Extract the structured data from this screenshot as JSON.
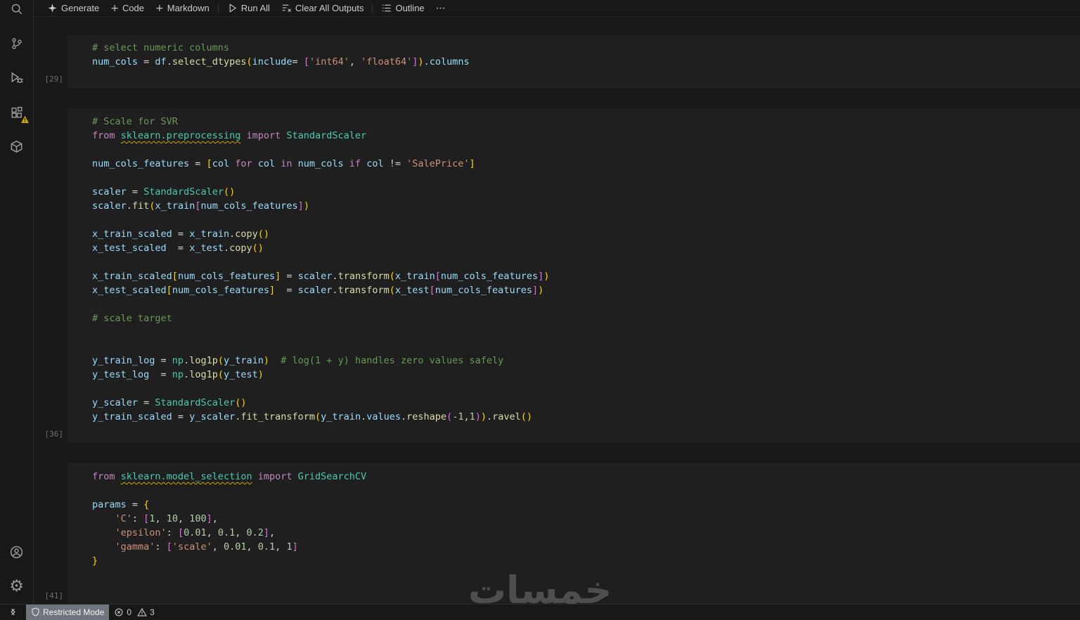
{
  "icons": {
    "plus": "+",
    "more": "⋯",
    "gear": "⚙"
  },
  "colors": {
    "background": "#181818",
    "cell_background": "#1f1f1f",
    "comment": "#6A9955",
    "keyword": "#C586C0",
    "variable": "#9CDCFE",
    "function": "#DCDCAA",
    "class": "#4EC9B0",
    "string": "#CE9178",
    "number": "#B5CEA8",
    "bracket1": "#FFD700",
    "bracket2": "#DA70D6",
    "warning_squiggle": "#CCA700"
  },
  "toolbar": {
    "generate": "Generate",
    "add_code": "Code",
    "add_markdown": "Markdown",
    "run_all": "Run All",
    "clear_all_outputs": "Clear All Outputs",
    "outline": "Outline"
  },
  "status_bar": {
    "restricted_mode": "Restricted Mode",
    "errors": "0",
    "warnings": "3"
  },
  "watermark": "خمسات",
  "cells": [
    {
      "execution_count": "[29]",
      "lines": [
        [
          [
            "c",
            "# select numeric columns"
          ]
        ],
        [
          [
            "v",
            "num_cols"
          ],
          [
            "o",
            " = "
          ],
          [
            "v",
            "df"
          ],
          [
            "p",
            "."
          ],
          [
            "f",
            "select_dtypes"
          ],
          [
            "b1",
            "("
          ],
          [
            "v",
            "include"
          ],
          [
            "o",
            "= "
          ],
          [
            "b2",
            "["
          ],
          [
            "s",
            "'int64'"
          ],
          [
            "p",
            ", "
          ],
          [
            "s",
            "'float64'"
          ],
          [
            "b2",
            "]"
          ],
          [
            "b1",
            ")"
          ],
          [
            "p",
            "."
          ],
          [
            "v",
            "columns"
          ]
        ]
      ]
    },
    {
      "execution_count": "[36]",
      "lines": [
        [
          [
            "c",
            "# Scale for SVR"
          ]
        ],
        [
          [
            "k",
            "from "
          ],
          [
            "mw",
            "sklearn.preprocessing"
          ],
          [
            "k",
            " import "
          ],
          [
            "cl",
            "StandardScaler"
          ]
        ],
        [],
        [
          [
            "v",
            "num_cols_features"
          ],
          [
            "o",
            " = "
          ],
          [
            "b1",
            "["
          ],
          [
            "v",
            "col"
          ],
          [
            "k",
            " for "
          ],
          [
            "v",
            "col"
          ],
          [
            "k",
            " in "
          ],
          [
            "v",
            "num_cols"
          ],
          [
            "k",
            " if "
          ],
          [
            "v",
            "col"
          ],
          [
            "o",
            " != "
          ],
          [
            "s",
            "'SalePrice'"
          ],
          [
            "b1",
            "]"
          ]
        ],
        [],
        [
          [
            "v",
            "scaler"
          ],
          [
            "o",
            " = "
          ],
          [
            "cl",
            "StandardScaler"
          ],
          [
            "b1",
            "()"
          ]
        ],
        [
          [
            "v",
            "scaler"
          ],
          [
            "p",
            "."
          ],
          [
            "f",
            "fit"
          ],
          [
            "b1",
            "("
          ],
          [
            "v",
            "x_train"
          ],
          [
            "b2",
            "["
          ],
          [
            "v",
            "num_cols_features"
          ],
          [
            "b2",
            "]"
          ],
          [
            "b1",
            ")"
          ]
        ],
        [],
        [
          [
            "v",
            "x_train_scaled"
          ],
          [
            "o",
            " = "
          ],
          [
            "v",
            "x_train"
          ],
          [
            "p",
            "."
          ],
          [
            "f",
            "copy"
          ],
          [
            "b1",
            "()"
          ]
        ],
        [
          [
            "v",
            "x_test_scaled"
          ],
          [
            "o",
            "  = "
          ],
          [
            "v",
            "x_test"
          ],
          [
            "p",
            "."
          ],
          [
            "f",
            "copy"
          ],
          [
            "b1",
            "()"
          ]
        ],
        [],
        [
          [
            "v",
            "x_train_scaled"
          ],
          [
            "b1",
            "["
          ],
          [
            "v",
            "num_cols_features"
          ],
          [
            "b1",
            "]"
          ],
          [
            "o",
            " = "
          ],
          [
            "v",
            "scaler"
          ],
          [
            "p",
            "."
          ],
          [
            "f",
            "transform"
          ],
          [
            "b1",
            "("
          ],
          [
            "v",
            "x_train"
          ],
          [
            "b2",
            "["
          ],
          [
            "v",
            "num_cols_features"
          ],
          [
            "b2",
            "]"
          ],
          [
            "b1",
            ")"
          ]
        ],
        [
          [
            "v",
            "x_test_scaled"
          ],
          [
            "b1",
            "["
          ],
          [
            "v",
            "num_cols_features"
          ],
          [
            "b1",
            "]"
          ],
          [
            "o",
            "  = "
          ],
          [
            "v",
            "scaler"
          ],
          [
            "p",
            "."
          ],
          [
            "f",
            "transform"
          ],
          [
            "b1",
            "("
          ],
          [
            "v",
            "x_test"
          ],
          [
            "b2",
            "["
          ],
          [
            "v",
            "num_cols_features"
          ],
          [
            "b2",
            "]"
          ],
          [
            "b1",
            ")"
          ]
        ],
        [],
        [
          [
            "c",
            "# scale target"
          ]
        ],
        [],
        [],
        [
          [
            "v",
            "y_train_log"
          ],
          [
            "o",
            " = "
          ],
          [
            "cl",
            "np"
          ],
          [
            "p",
            "."
          ],
          [
            "f",
            "log1p"
          ],
          [
            "b1",
            "("
          ],
          [
            "v",
            "y_train"
          ],
          [
            "b1",
            ")"
          ],
          [
            "c",
            "  # log(1 + y) handles zero values safely"
          ]
        ],
        [
          [
            "v",
            "y_test_log"
          ],
          [
            "o",
            "  = "
          ],
          [
            "cl",
            "np"
          ],
          [
            "p",
            "."
          ],
          [
            "f",
            "log1p"
          ],
          [
            "b1",
            "("
          ],
          [
            "v",
            "y_test"
          ],
          [
            "b1",
            ")"
          ]
        ],
        [],
        [
          [
            "v",
            "y_scaler"
          ],
          [
            "o",
            " = "
          ],
          [
            "cl",
            "StandardScaler"
          ],
          [
            "b1",
            "()"
          ]
        ],
        [
          [
            "v",
            "y_train_scaled"
          ],
          [
            "o",
            " = "
          ],
          [
            "v",
            "y_scaler"
          ],
          [
            "p",
            "."
          ],
          [
            "f",
            "fit_transform"
          ],
          [
            "b1",
            "("
          ],
          [
            "v",
            "y_train"
          ],
          [
            "p",
            "."
          ],
          [
            "v",
            "values"
          ],
          [
            "p",
            "."
          ],
          [
            "f",
            "reshape"
          ],
          [
            "b2",
            "("
          ],
          [
            "n",
            "-1"
          ],
          [
            "p",
            ","
          ],
          [
            "n",
            "1"
          ],
          [
            "b2",
            ")"
          ],
          [
            "b1",
            ")"
          ],
          [
            "p",
            "."
          ],
          [
            "f",
            "ravel"
          ],
          [
            "b1",
            "()"
          ]
        ]
      ]
    },
    {
      "execution_count": "[41]",
      "lines": [
        [
          [
            "k",
            "from "
          ],
          [
            "mw",
            "sklearn.model_selection"
          ],
          [
            "k",
            " import "
          ],
          [
            "cl",
            "GridSearchCV"
          ]
        ],
        [],
        [
          [
            "v",
            "params"
          ],
          [
            "o",
            " = "
          ],
          [
            "b1",
            "{"
          ]
        ],
        [
          [
            "p",
            "    "
          ],
          [
            "s",
            "'C'"
          ],
          [
            "p",
            ": "
          ],
          [
            "b2",
            "["
          ],
          [
            "n",
            "1"
          ],
          [
            "p",
            ", "
          ],
          [
            "n",
            "10"
          ],
          [
            "p",
            ", "
          ],
          [
            "n",
            "100"
          ],
          [
            "b2",
            "]"
          ],
          [
            "p",
            ","
          ]
        ],
        [
          [
            "p",
            "    "
          ],
          [
            "s",
            "'epsilon'"
          ],
          [
            "p",
            ": "
          ],
          [
            "b2",
            "["
          ],
          [
            "n",
            "0.01"
          ],
          [
            "p",
            ", "
          ],
          [
            "n",
            "0.1"
          ],
          [
            "p",
            ", "
          ],
          [
            "n",
            "0.2"
          ],
          [
            "b2",
            "]"
          ],
          [
            "p",
            ","
          ]
        ],
        [
          [
            "p",
            "    "
          ],
          [
            "s",
            "'gamma'"
          ],
          [
            "p",
            ": "
          ],
          [
            "b2",
            "["
          ],
          [
            "s",
            "'scale'"
          ],
          [
            "p",
            ", "
          ],
          [
            "n",
            "0.01"
          ],
          [
            "p",
            ", "
          ],
          [
            "n",
            "0.1"
          ],
          [
            "p",
            ", "
          ],
          [
            "n",
            "1"
          ],
          [
            "b2",
            "]"
          ]
        ],
        [
          [
            "b1",
            "}"
          ]
        ]
      ]
    }
  ]
}
